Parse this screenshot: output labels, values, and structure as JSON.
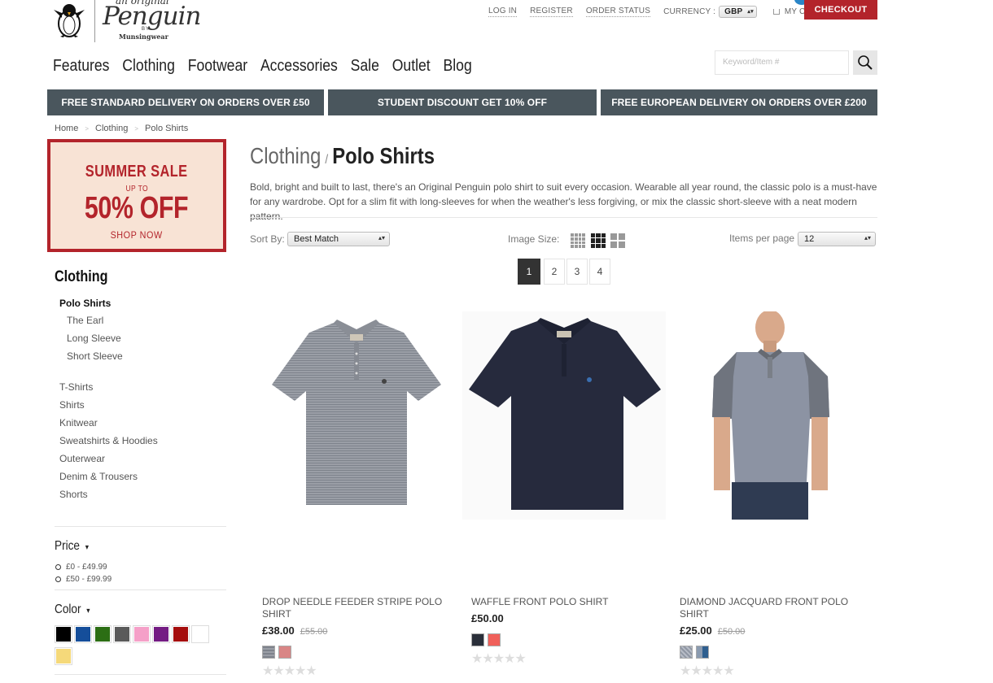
{
  "brand": {
    "logo_small": "an original",
    "logo_main": "Penguin",
    "logo_by": "BY",
    "logo_sub": "Munsingwear"
  },
  "top_links": {
    "login": "LOG IN",
    "register": "REGISTER",
    "order_status": "ORDER STATUS",
    "currency_label": "CURRENCY :",
    "currency_value": "GBP",
    "my_cart": "MY CART",
    "checkout": "CHECKOUT"
  },
  "main_nav": [
    "Features",
    "Clothing",
    "Footwear",
    "Accessories",
    "Sale",
    "Outlet",
    "Blog"
  ],
  "search": {
    "placeholder": "Keyword/Item #"
  },
  "promos": [
    "FREE STANDARD DELIVERY ON ORDERS OVER £50",
    "STUDENT DISCOUNT GET 10% OFF",
    "FREE EUROPEAN DELIVERY ON ORDERS OVER £200"
  ],
  "breadcrumb": [
    "Home",
    "Clothing",
    "Polo Shirts"
  ],
  "sale_banner": {
    "title": "SUMMER SALE",
    "upto": "UP TO",
    "big": "50% OFF",
    "cta": "SHOP NOW"
  },
  "sidebar": {
    "heading": "Clothing",
    "current": "Polo Shirts",
    "sub_items": [
      "The Earl",
      "Long Sleeve",
      "Short Sleeve"
    ],
    "categories": [
      "T-Shirts",
      "Shirts",
      "Knitwear",
      "Sweatshirts & Hoodies",
      "Outerwear",
      "Denim & Trousers",
      "Shorts"
    ],
    "price_heading": "Price",
    "price_options": [
      "£0 - £49.99",
      "£50 - £99.99"
    ],
    "color_heading": "Color",
    "colors": [
      "#000000",
      "#154e9a",
      "#2c6e14",
      "#5a5a5a",
      "#f5a0c8",
      "#741c83",
      "#a50d0d",
      "#ffffff",
      "#f5d97a"
    ]
  },
  "page": {
    "title_category": "Clothing",
    "title_separator": "/",
    "title_sub": "Polo Shirts",
    "description": "Bold, bright and built to last, there's an Original Penguin polo shirt to suit every occasion. Wearable all year round, the classic polo is a must-have for any wardrobe. Opt for a slim fit with long-sleeves for when the weather's less forgiving, or mix the classic short-sleeve with a neat modern pattern."
  },
  "controls": {
    "sort_label": "Sort By:",
    "sort_value": "Best Match",
    "image_size_label": "Image Size:",
    "items_per_page_label": "Items per page",
    "items_per_page_value": "12"
  },
  "pagination": {
    "pages": [
      "1",
      "2",
      "3",
      "4"
    ],
    "active": "1"
  },
  "products": [
    {
      "name": "DROP NEEDLE FEEDER STRIPE POLO SHIRT",
      "price": "£38.00",
      "was": "£55.00",
      "swatches": [
        "#8b8f98",
        "#d98686"
      ],
      "stars": "★★★★★"
    },
    {
      "name": "WAFFLE FRONT POLO SHIRT",
      "price": "£50.00",
      "was": "",
      "swatches": [
        "#2a2f3a",
        "#f0605a"
      ],
      "stars": "★★★★★"
    },
    {
      "name": "DIAMOND JACQUARD FRONT POLO SHIRT",
      "price": "£25.00",
      "was": "£50.00",
      "swatches": [
        "#8f96a3",
        "#5a7fa8"
      ],
      "stars": "★★★★★"
    }
  ]
}
